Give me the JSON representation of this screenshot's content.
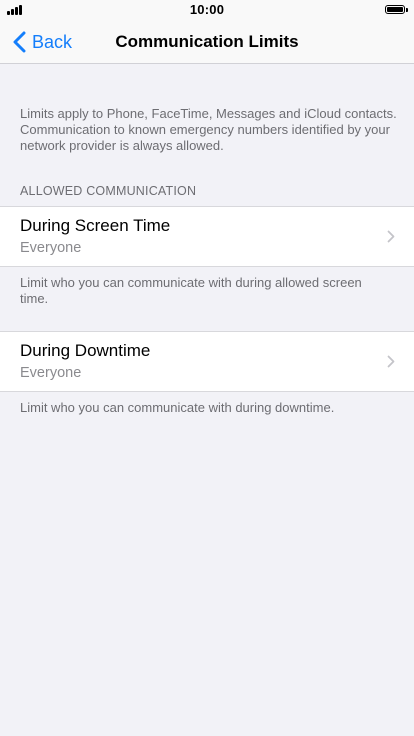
{
  "status_bar": {
    "time": "10:00"
  },
  "nav": {
    "back_label": "Back",
    "title": "Communication Limits"
  },
  "intro": "Limits apply to Phone, FaceTime, Messages and iCloud contacts. Communication to known emergency numbers identified by your network provider is always allowed.",
  "section_header": "ALLOWED COMMUNICATION",
  "rows": [
    {
      "title": "During Screen Time",
      "value": "Everyone",
      "footer": "Limit who you can communicate with during allowed screen time."
    },
    {
      "title": "During Downtime",
      "value": "Everyone",
      "footer": "Limit who you can communicate with during downtime."
    }
  ],
  "colors": {
    "accent": "#147efb",
    "background": "#f2f2f7",
    "secondary_text": "#6d6d72"
  }
}
